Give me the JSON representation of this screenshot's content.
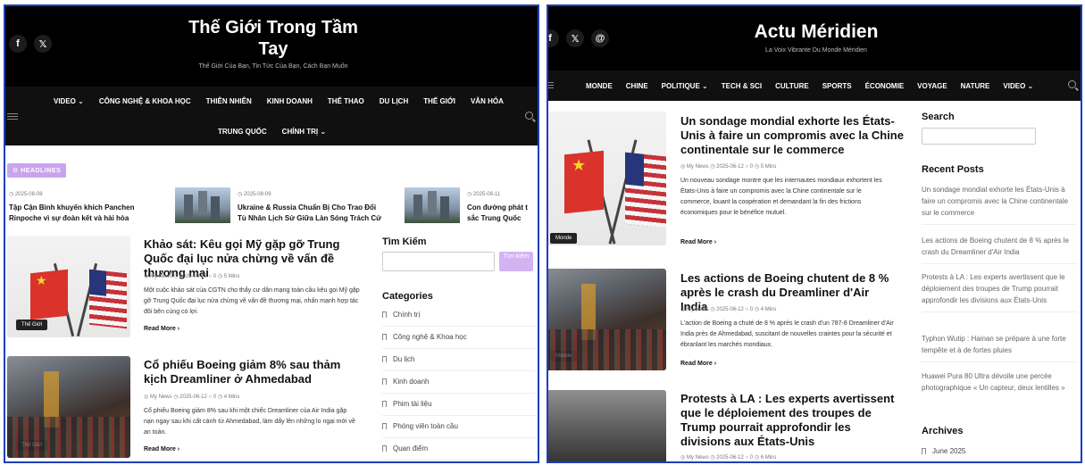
{
  "left": {
    "site_title_line1": "Thế Giới Trong Tầm",
    "site_title_line2": "Tay",
    "tagline": "Thế Giới Của Bạn, Tin Tức Của Bạn, Cách Bạn Muốn",
    "social": [
      "f",
      "𝕏"
    ],
    "nav_row1": [
      "VIDEO ⌄",
      "CÔNG NGHỆ & KHOA HỌC",
      "THIÊN NHIÊN",
      "KINH DOANH",
      "THỂ THAO",
      "DU LỊCH",
      "THẾ GIỚI",
      "VĂN HÓA"
    ],
    "nav_row2": [
      "TRUNG QUỐC",
      "CHÍNH TRỊ ⌄"
    ],
    "headlines_label": "⚙  HEADLINES",
    "headlines": [
      {
        "date": "◷ 2025-08-08",
        "line1": "Tập Cận Bình khuyến khích Panchen",
        "line2": "Rinpoche vì sự đoàn kết và hài hòa"
      },
      {
        "date": "◷ 2025-08-09",
        "line1": "Ukraine & Russia Chuẩn Bị Cho Trao Đổi",
        "line2": "Tù Nhân Lịch Sử Giữa Làn Sóng Trách Cứ"
      },
      {
        "date": "◷ 2025-08-11",
        "line1": "Con đường phát t",
        "line2": "sắc Trung Quốc"
      }
    ],
    "articles": [
      {
        "title": "Khảo sát: Kêu gọi Mỹ gặp gỡ Trung Quốc đại lục nửa chừng về vấn đề thương mại",
        "meta": "◎ My News   ◷ 2025-06-12   ○ 0   ◷ 5 Mins",
        "excerpt": "Một cuộc khảo sát của CGTN cho thấy cư dân mạng toàn cầu kêu gọi Mỹ gặp gỡ Trung Quốc đại lục nửa chừng về vấn đề thương mại, nhấn mạnh hợp tác đôi bên cùng có lợi.",
        "read_more": "Read More ›",
        "category": "Thế Giới"
      },
      {
        "title": "Cổ phiếu Boeing giảm 8% sau thảm kịch Dreamliner ở Ahmedabad",
        "meta": "◎ My News   ◷ 2025-06-12   ○ 0   ◷ 4 Mins",
        "excerpt": "Cổ phiếu Boeing giảm 8% sau khi một chiếc Dreamliner của Air India gặp nạn ngay sau khi cất cánh từ Ahmedabad, làm dấy lên những lo ngại mới về an toàn.",
        "read_more": "Read More ›",
        "category": "Thế Giới"
      }
    ],
    "sidebar": {
      "search_heading": "Tìm Kiếm",
      "search_button": "Tìm kiếm",
      "categories_heading": "Categories",
      "categories": [
        "Chính trị",
        "Công nghệ & Khoa học",
        "Du lịch",
        "Kinh doanh",
        "Phim tài liệu",
        "Phóng viên toàn cầu",
        "Quan điểm"
      ]
    }
  },
  "right": {
    "site_title": "Actu Méridien",
    "tagline": "La Voix Vibrante Du Monde Méridien",
    "social": [
      "f",
      "𝕏",
      "@"
    ],
    "nav": [
      "MONDE",
      "CHINE",
      "POLITIQUE ⌄",
      "TECH & SCI",
      "CULTURE",
      "SPORTS",
      "ÉCONOMIE",
      "VOYAGE",
      "NATURE",
      "VIDEO ⌄"
    ],
    "articles": [
      {
        "title": "Un sondage mondial exhorte les États-Unis à faire un compromis avec la Chine continentale sur le commerce",
        "meta": "◎ My News   ◷ 2025-06-12   ○ 0   ◷ 5 Mins",
        "excerpt": "Un nouveau sondage montre que les internautes mondiaux exhortent les États-Unis à faire un compromis avec la Chine continentale sur le commerce, louant la coopération et demandant la fin des frictions économiques pour le bénéfice mutuel.",
        "read_more": "Read More ›",
        "category": "Monde"
      },
      {
        "title": "Les actions de Boeing chutent de 8 % après le crash du Dreamliner d'Air India",
        "meta": "◎ My News   ◷ 2025-06-12   ○ 0   ◷ 4 Mins",
        "excerpt": "L'action de Boeing a chuté de 8 % après le crash d'un 787-8 Dreamliner d'Air India près de Ahmedabad, suscitant de nouvelles craintes pour la sécurité et ébranlant les marchés mondiaux.",
        "read_more": "Read More ›",
        "category": "Monde"
      },
      {
        "title": "Protests à LA : Les experts avertissent que le déploiement des troupes de Trump pourrait approfondir les divisions aux États-Unis",
        "meta": "◎ My News   ◷ 2025-06-12   ○ 0   ◷ 6 Mins"
      }
    ],
    "sidebar": {
      "search_heading": "Search",
      "recent_heading": "Recent Posts",
      "recent": [
        "Un sondage mondial exhorte les États-Unis à faire un compromis avec la Chine continentale sur le commerce",
        "Les actions de Boeing chutent de 8 % après le crash du Dreamliner d'Air India",
        "Protests à LA : Les experts avertissent que le déploiement des troupes de Trump pourrait approfondir les divisions aux États-Unis",
        "Typhon Wutip : Hainan se prépare à une forte tempête et à de fortes pluies",
        "Huawei Pura 80 Ultra dévoile une percée photographique « Un capteur, deux lentilles »"
      ],
      "archives_heading": "Archives",
      "archives": [
        "June 2025"
      ]
    }
  }
}
